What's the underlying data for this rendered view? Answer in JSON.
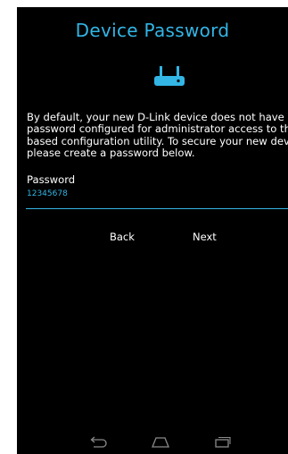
{
  "title": "Device Password",
  "icons": {
    "router": "router-icon",
    "back": "back-arrow-icon",
    "home": "home-icon",
    "recents": "recent-apps-icon"
  },
  "description_lines": [
    "By default, your new D-Link device does not have a",
    "password configured for administrator access to the Web",
    "based configuration utility. To secure your new device,",
    "please create a password below."
  ],
  "password": {
    "label": "Password",
    "value": "12345678"
  },
  "buttons": {
    "back": "Back",
    "next": "Next"
  },
  "colors": {
    "accent": "#33b5e5",
    "background": "#000000",
    "text": "#ffffff"
  }
}
